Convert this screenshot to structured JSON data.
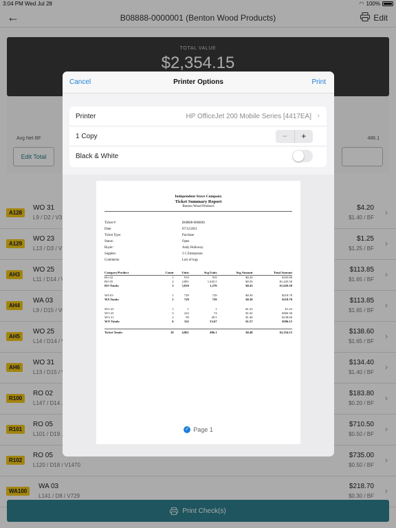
{
  "status": {
    "time": "3:04 PM",
    "date": "Wed Jul 28",
    "battery": "100%"
  },
  "nav": {
    "title": "B08888-0000001 (Benton Wood Products)",
    "edit": "Edit"
  },
  "summary": {
    "label": "TOTAL VALUE",
    "value": "$2,354.15",
    "avg_label": "Avg Net BF",
    "avg_value": "486.1",
    "edit_total": "Edit Total"
  },
  "rows": [
    {
      "badge": "A128",
      "name": "WO 31",
      "sub": "L9 / D2 / V3",
      "price": "$4.20",
      "bf": "$1.40 / BF"
    },
    {
      "badge": "A129",
      "name": "WO 23",
      "sub": "L13 / D3 / V",
      "price": "$1.25",
      "bf": "$1.25 / BF"
    },
    {
      "badge": "AH3",
      "name": "WO 25",
      "sub": "L11 / D14 / V",
      "price": "$113.85",
      "bf": "$1.65 / BF"
    },
    {
      "badge": "AH4",
      "name": "WA 03",
      "sub": "L9 / D15 / V6",
      "price": "$113.85",
      "bf": "$1.65 / BF"
    },
    {
      "badge": "AH5",
      "name": "WO 25",
      "sub": "L14 / D14 / V",
      "price": "$138.60",
      "bf": "$1.65 / BF"
    },
    {
      "badge": "AH6",
      "name": "WO 31",
      "sub": "L13 / D15 / V",
      "price": "$134.40",
      "bf": "$1.40 / BF"
    },
    {
      "badge": "R100",
      "name": "RO 02",
      "sub": "L147 / D14 ...",
      "price": "$183.80",
      "bf": "$0.20 / BF"
    },
    {
      "badge": "R101",
      "name": "RO 05",
      "sub": "L101 / D19 ...",
      "price": "$710.50",
      "bf": "$0.50 / BF"
    },
    {
      "badge": "R102",
      "name": "RO 05",
      "sub": "L120 / D18 / V1470",
      "price": "$735.00",
      "bf": "$0.50 / BF"
    },
    {
      "badge": "WA100",
      "name": "WA 03",
      "sub": "L141 / D8 / V729",
      "price": "$218.70",
      "bf": "$0.30 / BF"
    }
  ],
  "bottom": {
    "print_checks": "Print Check(s)"
  },
  "modal": {
    "cancel": "Cancel",
    "title": "Printer Options",
    "print": "Print",
    "printer_label": "Printer",
    "printer_value": "HP OfficeJet 200 Mobile Series [4417EA]",
    "copies_label": "1 Copy",
    "bw_label": "Black & White",
    "page_label": "Page 1"
  },
  "doc": {
    "company": "Independent Stave Company",
    "report": "Ticket Summary Report",
    "customer": "Benton Wood Products",
    "meta": [
      {
        "k": "Ticket #:",
        "v": "B08888-0000001"
      },
      {
        "k": "Date:",
        "v": "07/12/2021"
      },
      {
        "k": "Ticket Type:",
        "v": "Purchase"
      },
      {
        "k": "Status:",
        "v": "Open"
      },
      {
        "k": "Buyer:",
        "v": "Andy Holloway"
      },
      {
        "k": "Supplier",
        "v": "3 C Enterprises"
      },
      {
        "k": "Comments:",
        "v": "Lots of logs"
      }
    ],
    "headers": [
      "Category/Product",
      "Count",
      "Units",
      "Avg Units",
      "Avg Amount",
      "Total Amount"
    ],
    "table": [
      {
        "type": "row",
        "cells": [
          "RO 02",
          "1",
          "919",
          "919",
          "$0.20",
          "$183.80"
        ]
      },
      {
        "type": "row",
        "cells": [
          "RO 05",
          "2",
          "2,891",
          "1,445.5",
          "$0.50",
          "$1,445.50"
        ]
      },
      {
        "type": "total",
        "cells": [
          "RO Totals:",
          "3",
          "3,810",
          "1,270",
          "$0.43",
          "$1,629.30"
        ]
      },
      {
        "type": "gap",
        "cells": [
          "",
          "",
          "",
          "",
          "",
          ""
        ]
      },
      {
        "type": "row",
        "cells": [
          "WA 03",
          "1",
          "729",
          "729",
          "$0.30",
          "$218.70"
        ]
      },
      {
        "type": "total",
        "cells": [
          "WA Totals:",
          "1",
          "729",
          "729",
          "$0.30",
          "$218.70"
        ]
      },
      {
        "type": "gap",
        "cells": [
          "",
          "",
          "",
          "",
          "",
          ""
        ]
      },
      {
        "type": "row",
        "cells": [
          "WO 23",
          "1",
          "1",
          "1",
          "$1.25",
          "$1.25"
        ]
      },
      {
        "type": "row",
        "cells": [
          "WO 25",
          "3",
          "222",
          "74",
          "$1.65",
          "$366.30"
        ]
      },
      {
        "type": "row",
        "cells": [
          "WO 31",
          "2",
          "99",
          "49.5",
          "$1.40",
          "$138.60"
        ]
      },
      {
        "type": "total",
        "cells": [
          "WO Totals:",
          "6",
          "322",
          "53.67",
          "$1.57",
          "$506.15"
        ]
      },
      {
        "type": "gap",
        "cells": [
          "",
          "",
          "",
          "",
          "",
          ""
        ]
      },
      {
        "type": "grand",
        "cells": [
          "Ticket Totals:",
          "10",
          "4,861",
          "486.1",
          "$0.48",
          "$2,354.15"
        ]
      }
    ]
  }
}
